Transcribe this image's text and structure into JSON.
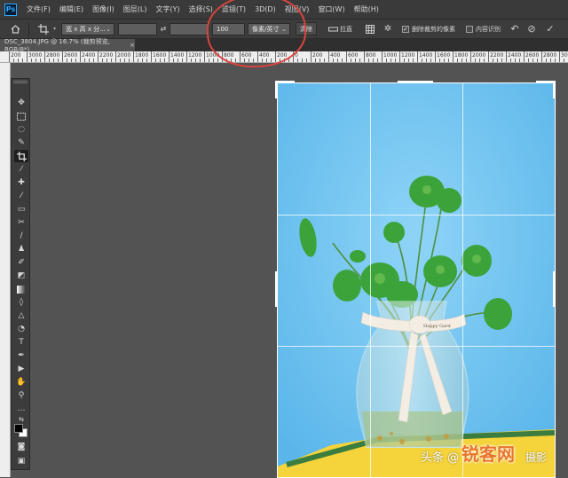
{
  "app": {
    "logo": "Ps"
  },
  "menu": [
    "文件(F)",
    "编辑(E)",
    "图像(I)",
    "图层(L)",
    "文字(Y)",
    "选择(S)",
    "滤镜(T)",
    "3D(D)",
    "视图(V)",
    "窗口(W)",
    "帮助(H)"
  ],
  "options": {
    "ratio_select": "宽 x 高 x 分...",
    "width_value": "",
    "height_value": "",
    "resolution_value": "100",
    "unit_select": "像素/英寸",
    "clear_label": "清除",
    "straighten_label": "拉直",
    "delete_cropped_label": "删除裁剪的像素",
    "delete_cropped_checked": true,
    "content_aware_label": "内容识别",
    "content_aware_checked": false
  },
  "document_tab": {
    "title": "DSC_3804.JPG @ 16.7% (裁剪预览, RGB/8*)",
    "close": "×"
  },
  "ruler_labels": [
    "200",
    "3000",
    "2800",
    "2600",
    "2400",
    "2200",
    "2000",
    "1800",
    "1600",
    "1400",
    "1200",
    "1000",
    "800",
    "600",
    "400",
    "200",
    "0",
    "200",
    "400",
    "600",
    "800",
    "1000",
    "1200",
    "1400",
    "1600",
    "1800",
    "2000",
    "2200",
    "2400",
    "2600",
    "2800",
    "3000",
    "3200"
  ],
  "tools": [
    "move-icon",
    "marquee-icon",
    "lasso-icon",
    "quick-select-icon",
    "crop-icon",
    "eyedropper-icon",
    "healing-icon",
    "brush-icon",
    "stamp-icon",
    "history-brush-icon",
    "eraser-icon",
    "gradient-icon",
    "blur-icon",
    "dodge-icon",
    "pen-icon",
    "text-icon",
    "path-select-icon",
    "shape-icon",
    "hand-icon",
    "zoom-icon"
  ],
  "watermark": {
    "platform": "头条 @",
    "site": "锐客网",
    "author": "摄影"
  },
  "colors": {
    "foreground": "#000000",
    "background": "#ffffff",
    "annotation": "#d9443f",
    "sky": "#7cc8f0"
  }
}
